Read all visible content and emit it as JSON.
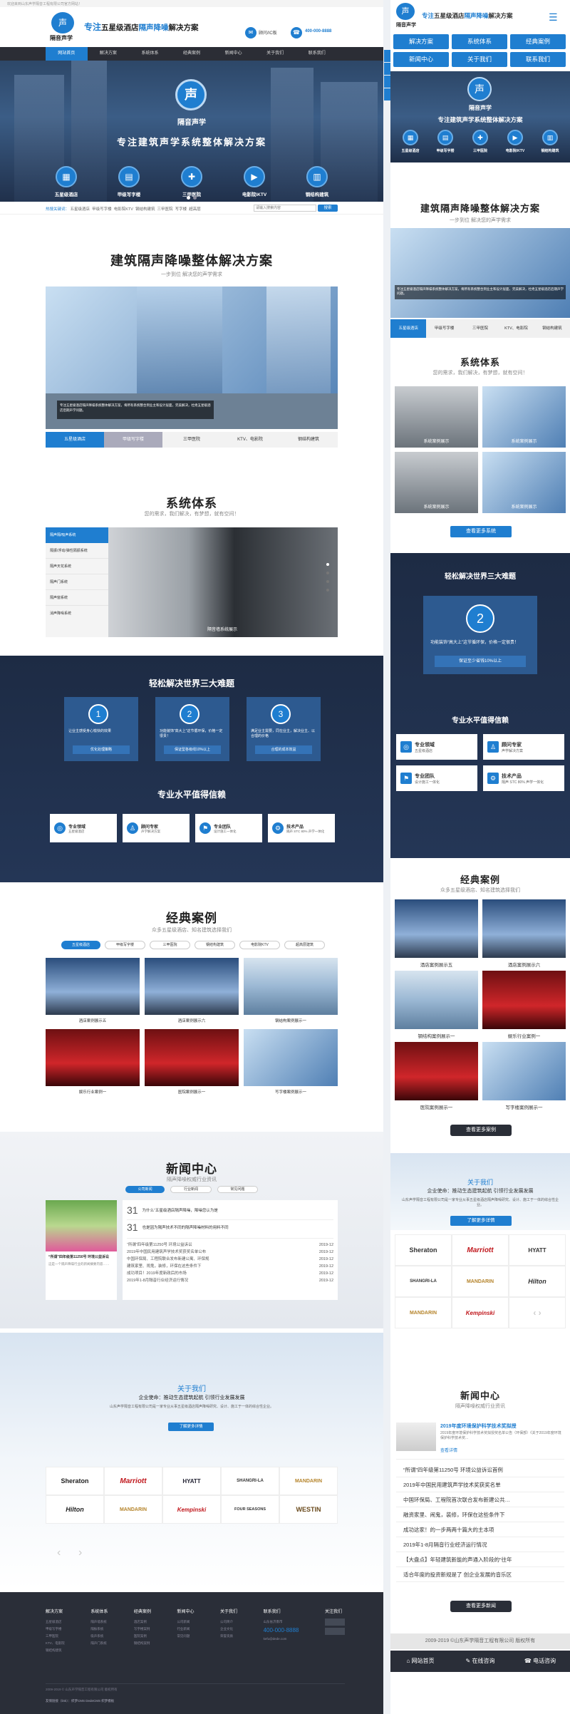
{
  "brand": {
    "name": "隔音声学",
    "slogan_a": "专注",
    "slogan_b": "五星级酒店",
    "slogan_c": "隔声降噪",
    "slogan_d": "解决方案",
    "hotline_label": "400-000-8888",
    "wechat_label": "顾问/IC板",
    "topbar_text": "欢迎来到山东声学隔音工程有限公司官方网站！"
  },
  "nav": [
    "网站首页",
    "解决方案",
    "系统体系",
    "经典案例",
    "新闻中心",
    "关于我们",
    "联系我们"
  ],
  "hero": {
    "logo_text": "隔音声学",
    "headline": "专注建筑声学系统整体解决方案",
    "icons": [
      "五星级酒店",
      "甲级写字楼",
      "三甲医院",
      "电影院\\KTV",
      "钢结构建筑"
    ]
  },
  "search": {
    "label": "热搜关键词：",
    "keywords": [
      "五星级酒店",
      "甲级写字楼",
      "电影院KTV",
      "钢结构建筑",
      "三甲医院",
      "写字楼",
      "超高层"
    ],
    "placeholder": "请输入搜索内容",
    "button": "搜索"
  },
  "solution": {
    "title": "建筑隔声降噪整体解决方案",
    "subtitle": "一步到位 解决您的声学需求",
    "caption": "专注五星级酒店隔声降噪系统整体解决方案，将所有系统整合到业主和设计层面，完美解决，杜绝五星级酒店后期声学问题。",
    "tabs": [
      "五星级酒店",
      "甲级写字楼",
      "三甲医院",
      "KTV、电影院",
      "钢结构建筑"
    ],
    "m_tabs": [
      "五星级酒店",
      "甲级写字楼",
      "三甲医院",
      "KTV、电影院",
      "钢结构建筑"
    ]
  },
  "system": {
    "title": "系统体系",
    "subtitle": "您的需求，我们解决，有梦想，就有空间！",
    "menu": [
      "隔声隔/吸声系统",
      "隔振/浮动/弹性隔振系统",
      "隔声天花系统",
      "隔声门系统",
      "隔声窗系统",
      "消声降噪系统"
    ],
    "caption": "隔音墙系统展示",
    "m_cases": [
      "系统案例展示",
      "系统案例展示",
      "系统案例展示",
      "系统案例展示"
    ],
    "m_more": "查看更多系统"
  },
  "problems": {
    "title": "轻松解决世界三大难题",
    "nums": [
      "1",
      "2",
      "3"
    ],
    "texts": [
      "让业主感受身心愉快的效果",
      "功能装饰“高大上”这节循环保，价格一定很贵！",
      "满足业主需要，同在业主，解决业主、以合理的价格"
    ],
    "btns": [
      "优化处理策略",
      "保证型各级线10%以上",
      "合理的成本效益"
    ],
    "m_num": "2",
    "m_text": "功能装饰“高大上”这节循环保，价格一定很贵！",
    "m_btn": "保证至少省钱10%以上"
  },
  "pro": {
    "title": "专业水平值得信赖",
    "items": [
      {
        "t": "专业领域",
        "s": "五星级酒店"
      },
      {
        "t": "顾问专家",
        "s": "声学解决方案"
      },
      {
        "t": "专业团队",
        "s": "设计施工一体化"
      },
      {
        "t": "技术产品",
        "s": "隔声 STC 80% 声学一体化"
      }
    ]
  },
  "cases": {
    "title": "经典案例",
    "subtitle": "众多五星级酒店、知名建筑选择我们",
    "tabs": [
      "五星级酒店",
      "甲级写字楼",
      "三甲医院",
      "钢结构建筑",
      "电影院KTV",
      "超高层建筑"
    ],
    "items": [
      "酒店案例展示五",
      "酒店案例展示六",
      "钢结构案例展示一",
      "娱乐行业案例一",
      "医院案例展示一",
      "写字楼案例展示一"
    ],
    "m_items": [
      "酒店案例展示五",
      "酒店案例展示六",
      "钢结构案例展示一",
      "娱乐行业案例一",
      "医院案例展示一",
      "写字楼案例展示一"
    ],
    "m_more": "查看更多案例"
  },
  "news": {
    "title": "新闻中心",
    "subtitle": "隔声降噪权威行业资讯",
    "tabs": [
      "公司新闻",
      "行业新闻",
      "常见问题"
    ],
    "feature_title": "“所谓”四年级第11250号 环境公益诉讼",
    "feature_desc": "这是一个隔声降噪行业的新闻摘要内容……",
    "dates": [
      "31",
      "31"
    ],
    "month": "2019-12",
    "headline1": "为什么“五星级酒店隔声降噪，降噪您认为是",
    "headline2": "也是因为隔声技术不同的隔声降噪材料的用料不同",
    "list": [
      "“所谓”四年级第11250号 环境公益诉讼",
      "2019年中国民用建筑声学技术奖获奖名单公布",
      "中国环保局、工程院联合发布新建公寓、环保规",
      "建筑家里、闹鬼，装修，环保在这些条件下",
      "成功项目！2019年度新政后的市场",
      "2019年1-8月隔音行业经济运行情况"
    ],
    "m_feature": "2019年度环境保护科学技术奖拟授",
    "m_feature_desc": "2019年度环境保护科学技术奖拟授奖名单公告（环保部）《关于2019年度环境保护科学技术奖...",
    "m_feature_link": "查看详情",
    "m_list": [
      "“所谓”四年级第11250号 环境公益诉讼首例",
      "2019年中国民用建筑声学技术奖获奖名单",
      "中国环保局、工程院首次联合发布新建公共…",
      "融资家里、闹鬼，装修，环保在这些条件下",
      "成功这家！的一步两两十篇大的主本项",
      "2019年1-8月隔音行业经济运行情况",
      "【大盘点】年轻建筑新能的声通入阶段的“往年",
      "适合年度的投资新规是了 创企业发展的音乐区"
    ],
    "m_more": "查看更多新闻"
  },
  "about": {
    "title": "关于我们",
    "tagline": "企业使命：推动生态建筑起航 引领行业发展发展",
    "desc": "山东声学隔音工程有限公司是一家专业从事五星级酒店隔声降噪研究、设计、施工于一体的综合性企业。",
    "btn": "了解更多详情",
    "m_btn": "了解更多详情"
  },
  "partners": [
    "Sheraton",
    "Marriott",
    "HYATT",
    "SHANGRI-LA",
    "Hilton",
    "Kempinski",
    "FOUR SEASONS",
    "WESTIN",
    "MANDARIN"
  ],
  "footer": {
    "cols": [
      {
        "h": "解决方案",
        "items": [
          "五星级酒店",
          "甲级写字楼",
          "三甲医院",
          "KTV、电影院",
          "钢结构建筑"
        ]
      },
      {
        "h": "系统体系",
        "items": [
          "隔声墙系统",
          "隔振系统",
          "吸声系统",
          "隔声门系统"
        ]
      },
      {
        "h": "经典案例",
        "items": [
          "酒店案例",
          "写字楼案例",
          "医院案例",
          "钢结构案例"
        ]
      },
      {
        "h": "新闻中心",
        "items": [
          "公司新闻",
          "行业新闻",
          "常见问题"
        ]
      },
      {
        "h": "关于我们",
        "items": [
          "公司简介",
          "企业文化",
          "荣誉资质"
        ]
      },
      {
        "h": "联系我们",
        "items": [
          "山东省济南市",
          "400-000-8888",
          "kefu@dede.com"
        ]
      }
    ],
    "follow": "关注我们",
    "phone": "400-000-8888",
    "copyright": "2009-2019 © 山东声学隔音工程有限公司 版权所有",
    "links": "友情链接（link）：织梦CMS  DedeCMS  织梦模板"
  },
  "mobile": {
    "btns": [
      "解决方案",
      "系统体系",
      "经典案例",
      "新闻中心",
      "关于我们",
      "联系我们"
    ],
    "copyright": "2009-2019 ©山东声学隔音工程有限公司 版权所有",
    "bottom": [
      "网站首页",
      "在线咨询",
      "电话咨询"
    ]
  }
}
